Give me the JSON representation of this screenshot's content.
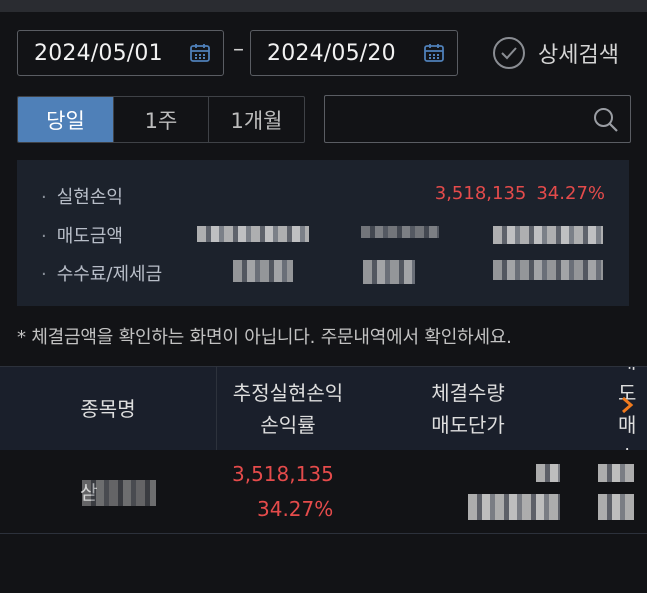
{
  "date_range": {
    "start": "2024/05/01",
    "end": "2024/05/20",
    "separator": "–"
  },
  "detail_search": {
    "label": "상세검색"
  },
  "period_tabs": [
    {
      "label": "당일",
      "active": true
    },
    {
      "label": "1주",
      "active": false
    },
    {
      "label": "1개월",
      "active": false
    }
  ],
  "search": {
    "placeholder": ""
  },
  "summary": {
    "realized_pnl": {
      "label": "실현손익",
      "value": "3,518,135",
      "rate": "34.27%"
    },
    "sell_amount": {
      "label": "매도금액"
    },
    "fee_tax": {
      "label": "수수료/제세금"
    }
  },
  "notice": "* 체결금액을 확인하는 화면이 아닙니다. 주문내역에서 확인하세요.",
  "table": {
    "headers": [
      {
        "line1": "종목명",
        "line2": ""
      },
      {
        "line1": "추정실현손익",
        "line2": "손익률"
      },
      {
        "line1": "체결수량",
        "line2": "매도단가"
      },
      {
        "line1": "매도",
        "line2": "매수"
      }
    ],
    "rows": [
      {
        "name_visible": "삳",
        "pnl": "3,518,135",
        "rate": "34.27%"
      }
    ]
  },
  "colors": {
    "accent": "#4f80b8",
    "profit": "#e44b4b",
    "chevron": "#f07a1e"
  }
}
